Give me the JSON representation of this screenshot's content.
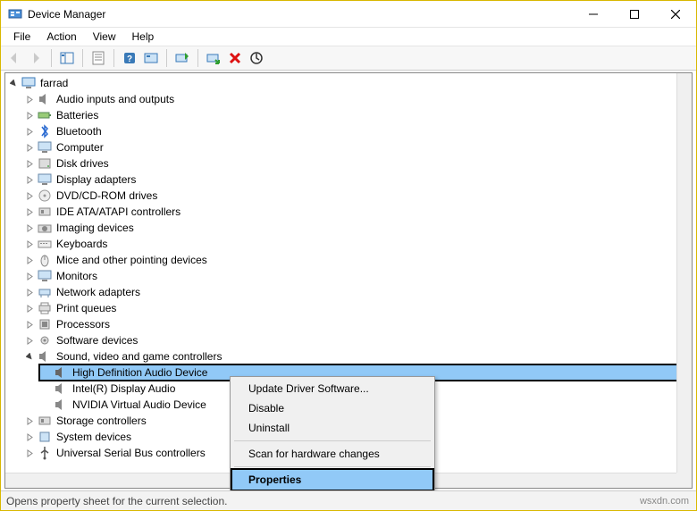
{
  "window": {
    "title": "Device Manager"
  },
  "menu": {
    "file": "File",
    "action": "Action",
    "view": "View",
    "help": "Help"
  },
  "status": {
    "text": "Opens property sheet for the current selection."
  },
  "watermark": "wsxdn.com",
  "tree": {
    "root": "farrad",
    "nodes": [
      "Audio inputs and outputs",
      "Batteries",
      "Bluetooth",
      "Computer",
      "Disk drives",
      "Display adapters",
      "DVD/CD-ROM drives",
      "IDE ATA/ATAPI controllers",
      "Imaging devices",
      "Keyboards",
      "Mice and other pointing devices",
      "Monitors",
      "Network adapters",
      "Print queues",
      "Processors",
      "Software devices"
    ],
    "sound": {
      "label": "Sound, video and game controllers",
      "children": [
        "High Definition Audio Device",
        "Intel(R) Display Audio",
        "NVIDIA Virtual Audio Device"
      ]
    },
    "after": [
      "Storage controllers",
      "System devices",
      "Universal Serial Bus controllers"
    ]
  },
  "context_menu": {
    "update": "Update Driver Software...",
    "disable": "Disable",
    "uninstall": "Uninstall",
    "scan": "Scan for hardware changes",
    "properties": "Properties"
  },
  "icons": {
    "audio_io": "speaker",
    "batteries": "battery",
    "bluetooth": "bluetooth",
    "computer": "monitor",
    "disk": "disk",
    "display": "monitor",
    "dvd": "disc",
    "ide": "controller",
    "imaging": "camera",
    "keyboards": "keyboard",
    "mice": "mouse",
    "monitors": "monitor",
    "network": "network",
    "print": "printer",
    "processors": "cpu",
    "software": "gear",
    "sound": "speaker",
    "storage": "controller",
    "system": "chip",
    "usb": "usb"
  }
}
